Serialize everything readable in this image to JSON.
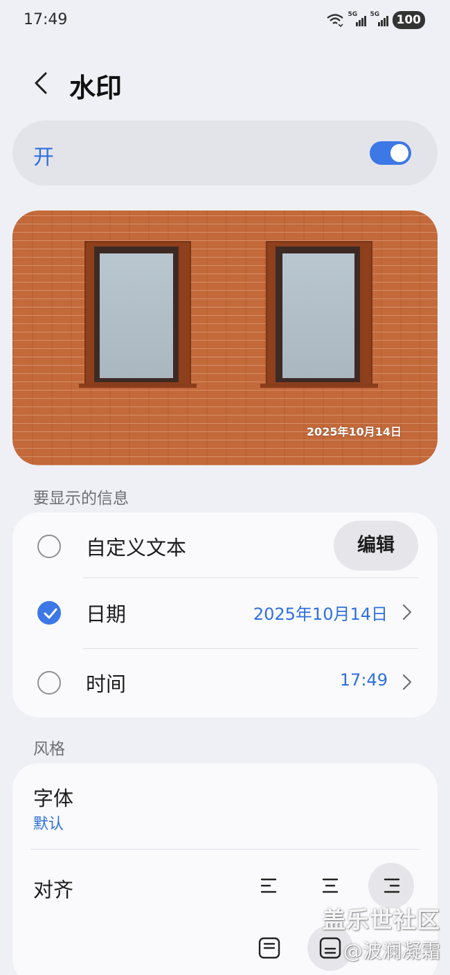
{
  "status_bar": {
    "time": "17:49",
    "network_1": "5G",
    "network_2": "5G",
    "battery": "100"
  },
  "header": {
    "title": "水印"
  },
  "master_toggle": {
    "label": "开",
    "enabled": true
  },
  "preview": {
    "watermark_text": "2025年10月14日"
  },
  "info_section": {
    "title": "要显示的信息",
    "rows": [
      {
        "label": "自定义文本",
        "checked": false,
        "action_label": "编辑"
      },
      {
        "label": "日期",
        "checked": true,
        "value": "2025年10月14日"
      },
      {
        "label": "时间",
        "checked": false,
        "value": "17:49"
      }
    ]
  },
  "style_section": {
    "title": "风格",
    "font_title": "字体",
    "font_value": "默认",
    "align_title": "对齐",
    "align_options": [
      "left-align-icon",
      "center-align-icon",
      "right-align-icon"
    ],
    "align_selected": "right",
    "position_options": [
      "top-position-icon",
      "bottom-position-icon"
    ],
    "position_selected": "bottom"
  },
  "overlay": {
    "community": "盖乐世社区",
    "author": "@波澜凝霜"
  },
  "colors": {
    "accent": "#3c78e6",
    "background": "#eff0f5",
    "card": "#fafafd"
  }
}
